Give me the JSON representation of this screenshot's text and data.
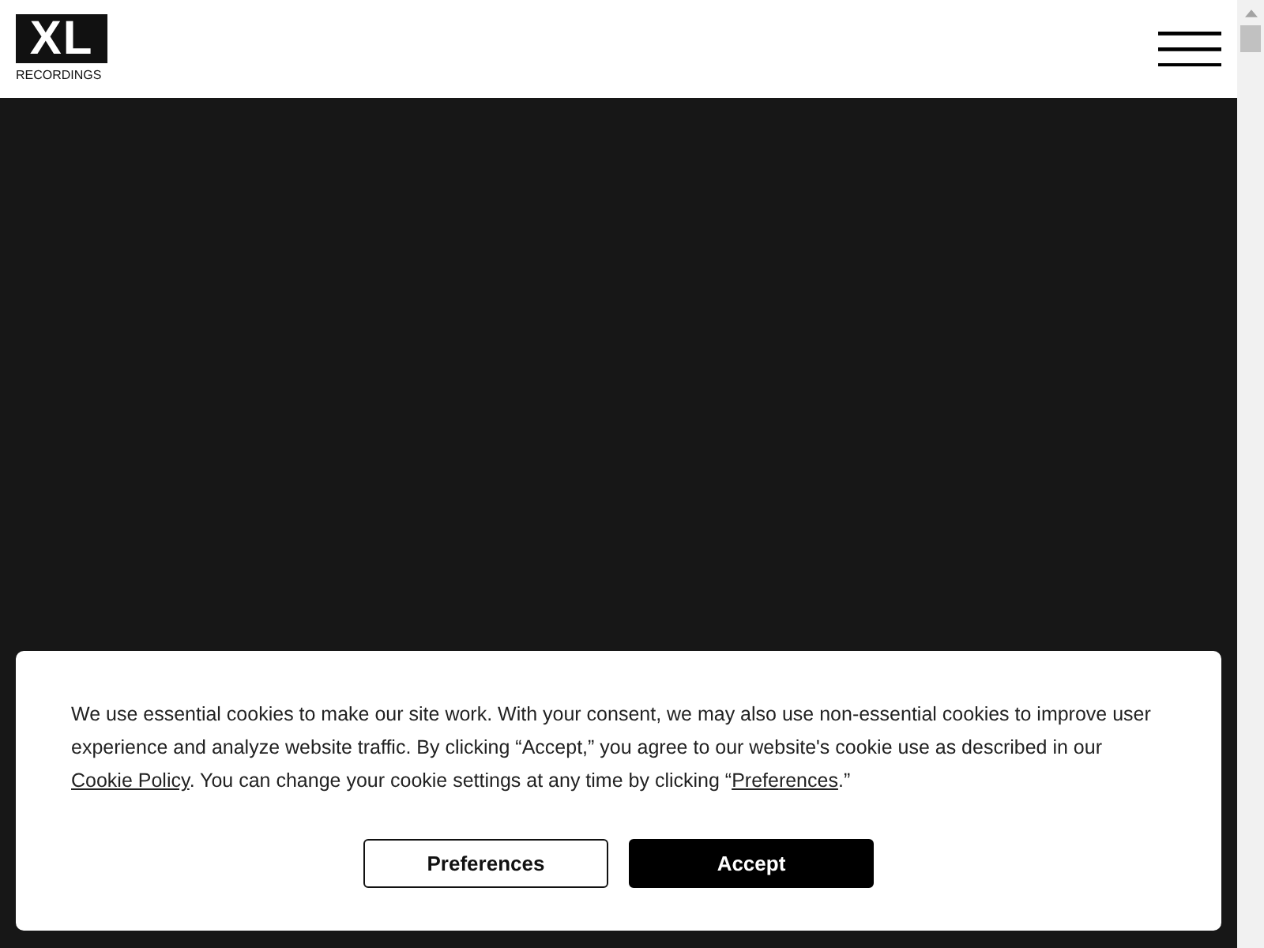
{
  "header": {
    "logo": {
      "mark": "XL",
      "subtitle": "RECORDINGS"
    }
  },
  "cookie_notice": {
    "segments": [
      {
        "kind": "text",
        "text": "We use essential cookies to make our site work. With your consent, we may also use non-essential cookies to improve user experience and analyze website traffic. By clicking “Accept,” you agree to our website's cookie use as described in our "
      },
      {
        "kind": "link",
        "text": "Cookie Policy"
      },
      {
        "kind": "text",
        "text": ". You can change your cookie settings at any time by clicking “"
      },
      {
        "kind": "link",
        "text": "Preferences"
      },
      {
        "kind": "text",
        "text": ".”"
      }
    ],
    "buttons": [
      {
        "label": "Preferences",
        "kind": "secondary"
      },
      {
        "label": "Accept",
        "kind": "primary"
      }
    ]
  }
}
